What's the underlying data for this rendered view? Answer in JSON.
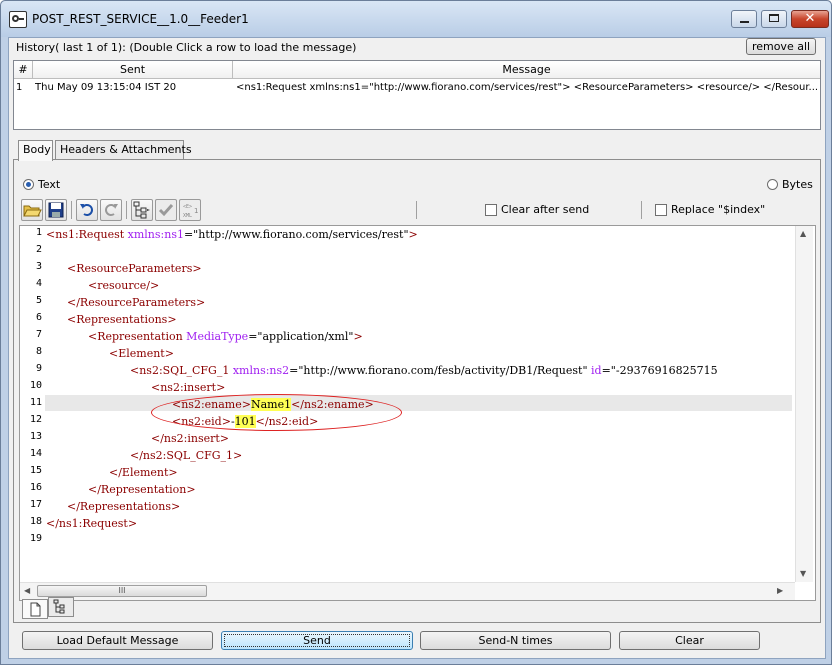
{
  "window": {
    "title": "POST_REST_SERVICE__1.0__Feeder1"
  },
  "history": {
    "label": "History( last 1 of 1):    (Double Click a row to load the message)",
    "remove_all": "remove all",
    "columns": [
      "#",
      "Sent",
      "Message"
    ],
    "rows": [
      {
        "num": "1",
        "sent": "Thu May 09 13:15:04 IST 20",
        "message": "<ns1:Request xmlns:ns1=\"http://www.fiorano.com/services/rest\">   <ResourceParameters>      <resource/>    </Resour..."
      }
    ]
  },
  "tabs": [
    "Body",
    "Headers & Attachments"
  ],
  "body": {
    "text_label": "Text",
    "bytes_label": "Bytes",
    "clear_after_send": "Clear after send",
    "replace_index": "Replace \"$index\""
  },
  "editor": {
    "line_numbers": [
      "1",
      "2",
      "3",
      "4",
      "5",
      "6",
      "7",
      "8",
      "9",
      "10",
      "11",
      "12",
      "13",
      "14",
      "15",
      "16",
      "17",
      "18",
      "19"
    ],
    "lines": {
      "l1_tag": "<ns1:Request",
      "l1_attr": " xmlns:ns1",
      "l1_val": "=\"http://www.fiorano.com/services/rest\"",
      "l1_close": ">",
      "l3": "<ResourceParameters>",
      "l4": "<resource/>",
      "l5": "</ResourceParameters>",
      "l6": "<Representations>",
      "l7_tag": "<Representation",
      "l7_attr": " MediaType",
      "l7_val": "=\"application/xml\"",
      "l7_close": ">",
      "l8": "<Element>",
      "l9_tag": "<ns2:SQL_CFG_1",
      "l9_attr": " xmlns:ns2",
      "l9_val": "=\"http://www.fiorano.com/fesb/activity/DB1/Request\"",
      "l9_attr2": " id",
      "l9_val2": "=\"-29376916825715",
      "l10": "<ns2:insert>",
      "l11_open": "<ns2:ename>",
      "l11_value": "Name1",
      "l11_close": "</ns2:ename>",
      "l12_open": "<ns2:eid>",
      "l12_dash": "-",
      "l12_value": "101",
      "l12_close": "</ns2:eid>",
      "l13": "</ns2:insert>",
      "l14": "</ns2:SQL_CFG_1>",
      "l15": "</Element>",
      "l16": "</Representation>",
      "l17": "</Representations>",
      "l18": "</ns1:Request>"
    },
    "hscroll_grip": "III"
  },
  "buttons": {
    "load_default": "Load Default Message",
    "send": "Send",
    "send_n": "Send-N times",
    "clear": "Clear"
  }
}
